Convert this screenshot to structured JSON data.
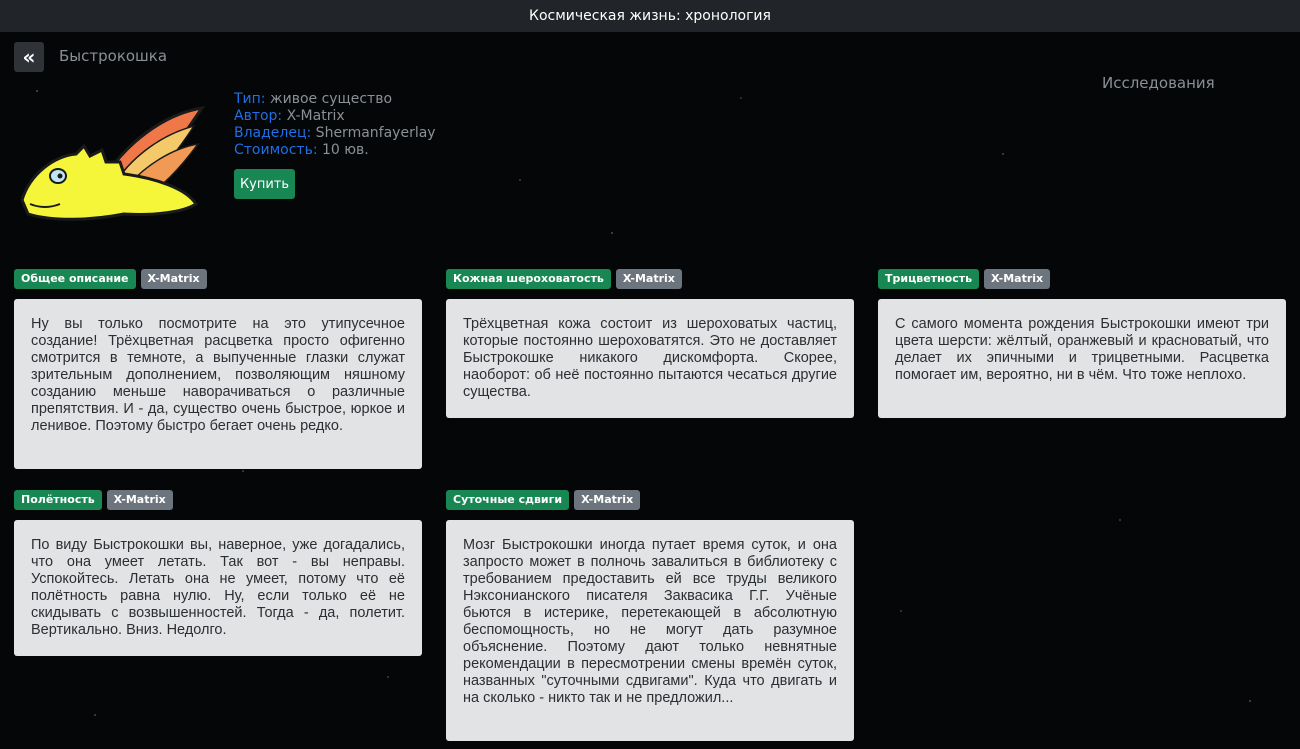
{
  "window": {
    "title": "Космическая жизнь: хронология"
  },
  "nav": {
    "back_icon": "double-chevron-left-icon",
    "breadcrumb": "Быстрокошка",
    "research_link": "Исследования"
  },
  "creature": {
    "image_icon": "yellow-winged-creature-icon",
    "colors": {
      "body": "#f5f53a",
      "wing_outer": "#f07848",
      "wing_inner": "#f3c96a",
      "outline": "#1a1a1a"
    },
    "info": [
      {
        "key": "Тип:",
        "value": " живое существо"
      },
      {
        "key": "Автор:",
        "value": " X-Matrix"
      },
      {
        "key": "Владелец:",
        "value": " Shermanfayerlay"
      },
      {
        "key": "Стоимость:",
        "value": " 10 юв."
      }
    ],
    "buy_label": "Купить"
  },
  "colors": {
    "accent_green": "#198754",
    "tag_gray": "#6c757d",
    "link_blue": "#1f6fe6",
    "card_bg": "#e2e3e5",
    "titlebar": "#212529"
  },
  "cards": [
    {
      "title": "Общее описание",
      "author": "X-Matrix",
      "text": "Ну вы только посмотрите на это утипусечное создание! Трёхцветная расцветка просто офигенно смотрится в темноте, а выпученные глазки служат зрительным дополнением, позволяющим няшному созданию меньше наворачиваться о различные препятствия. И - да, существо очень быстрое, юркое и ленивое. Поэтому быстро бегает очень редко."
    },
    {
      "title": "Кожная шероховатость",
      "author": "X-Matrix",
      "text": "Трёхцветная кожа состоит из шероховатых частиц, которые постоянно шероховатятся. Это не доставляет Быстрокошке никакого дискомфорта. Скорее, наоборот: об неё постоянно пытаются чесаться другие существа."
    },
    {
      "title": "Трицветность",
      "author": "X-Matrix",
      "text": "С самого момента рождения Быстрокошки имеют три цвета шерсти: жёлтый, оранжевый и красноватый, что делает их эпичными и трицветными. Расцветка помогает им, вероятно, ни в чём. Что тоже неплохо."
    },
    {
      "title": "Полётность",
      "author": "X-Matrix",
      "text": "По виду Быстрокошки вы, наверное, уже догадались, что она умеет летать. Так вот - вы неправы. Успокойтесь. Летать она не умеет, потому что её полётность равна нулю. Ну, если только её не скидывать с возвышенностей. Тогда - да, полетит. Вертикально. Вниз. Недолго."
    },
    {
      "title": "Суточные сдвиги",
      "author": "X-Matrix",
      "text": "Мозг Быстрокошки иногда путает время суток, и она запросто может в полночь завалиться в библиотеку с требованием предоставить ей все труды великого Нэксонианского писателя Заквасика Г.Г. Учёные бьются в истерике, перетекающей в абсолютную беспомощность, но не могут дать разумное объяснение. Поэтому дают только невнятные рекомендации в пересмотрении смены времён суток, названных \"суточными сдвигами\". Куда что двигать и на сколько - никто так и не предложил..."
    }
  ]
}
